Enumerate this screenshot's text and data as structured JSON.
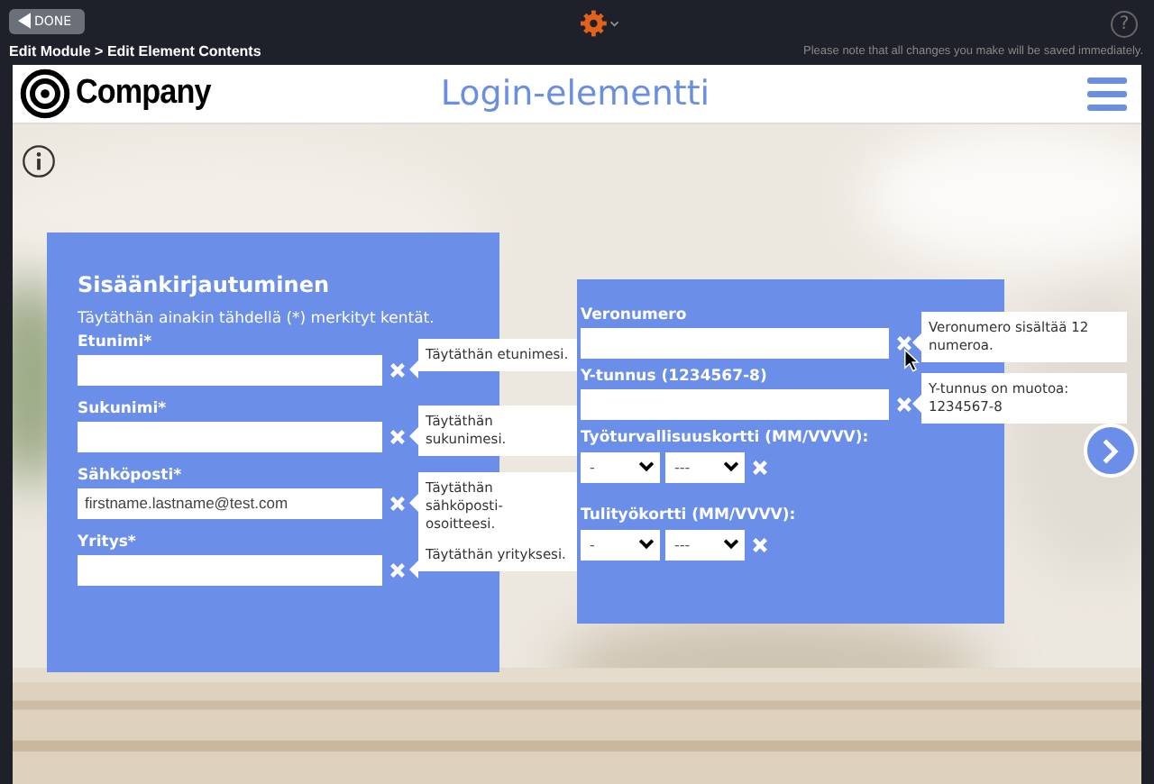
{
  "toolbar": {
    "done_button": "DONE",
    "help": "?"
  },
  "breadcrumb": "Edit Module > Edit Element Contents",
  "notice": "Please note that all changes you make will be saved immediately.",
  "header": {
    "logo_text": "Company",
    "title": "Login-elementti"
  },
  "login_card": {
    "title": "Sisäänkirjautuminen",
    "intro": "Täytäthän ainakin tähdellä (*) merkityt kentät.",
    "fields": [
      {
        "label": "Etunimi*",
        "tooltip": "Täytäthän etunimesi."
      },
      {
        "label": "Sukunimi*",
        "tooltip": "Täytäthän sukunimesi."
      },
      {
        "label": "Sähköposti*",
        "value": "firstname.lastname@test.com",
        "tooltip": "Täytäthän sähköposti-osoitteesi."
      },
      {
        "label": "Yritys*",
        "tooltip": "Täytäthän yrityksesi."
      }
    ]
  },
  "extra_card": {
    "fields": [
      {
        "kind": "text",
        "label": "Veronumero",
        "tooltip": "Veronumero sisältää 12 numeroa."
      },
      {
        "kind": "text",
        "label": "Y-tunnus (1234567-8)",
        "tooltip": "Y-tunnus on muotoa: 1234567-8"
      },
      {
        "kind": "date",
        "label": "Työturvallisuuskortti (MM/VVVV):",
        "month": "-",
        "year": "---"
      },
      {
        "kind": "date",
        "label": "Tulityökortti (MM/VVVV):",
        "month": "-",
        "year": "---"
      }
    ]
  }
}
